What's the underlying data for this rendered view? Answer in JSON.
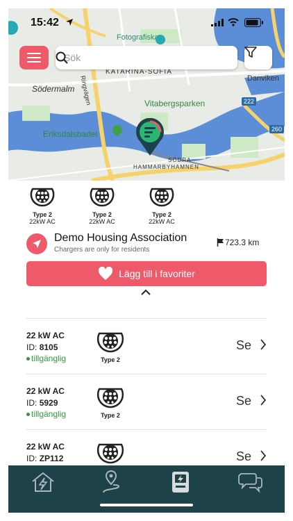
{
  "status_bar": {
    "time": "15:42"
  },
  "map": {
    "labels": {
      "fotografiska": "Fotografiska",
      "katarina": "KATARINA-SOFIA",
      "sodermalm": "Södermalm",
      "vitabergsparken": "Vitabergsparken",
      "eriksdalsbadet": "Eriksdalsbadet",
      "danviken": "Danviken",
      "sodra1": "SÖDRA",
      "sodra2": "HAMMARBYHAMNEN",
      "road222": "222",
      "road260": "260",
      "street": "Ringvägen"
    }
  },
  "search": {
    "placeholder": "Sök"
  },
  "connectors": [
    {
      "type": "Type 2",
      "power": "22kW AC"
    },
    {
      "type": "Type 2",
      "power": "22kW AC"
    },
    {
      "type": "Type 2",
      "power": "22kW AC"
    }
  ],
  "station": {
    "name": "Demo Housing Association",
    "subtitle": "Chargers are only for residents",
    "distance": "723.3 km"
  },
  "favorite_button": {
    "label": "Lägg till i favoriter"
  },
  "chargers": [
    {
      "power": "22 kW AC",
      "id_label": "ID:",
      "id": "8105",
      "status": "tillgänglig",
      "type": "Type 2",
      "action": "Se"
    },
    {
      "power": "22 kW AC",
      "id_label": "ID:",
      "id": "5929",
      "status": "tillgänglig",
      "type": "Type 2",
      "action": "Se"
    },
    {
      "power": "22 kW AC",
      "id_label": "ID:",
      "id": "ZP112",
      "status": "",
      "type": "",
      "action": "Se"
    }
  ],
  "colors": {
    "accent": "#ef5a6b",
    "tabbar": "#1e4249",
    "available": "#2f9a3c"
  }
}
